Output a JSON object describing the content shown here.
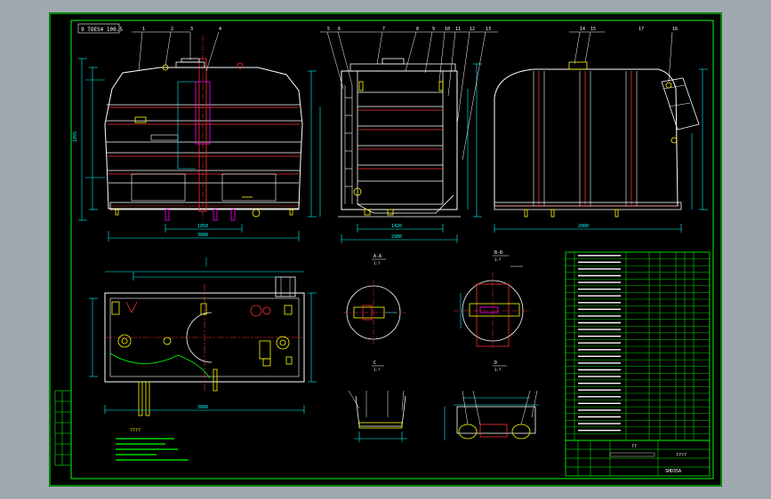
{
  "colors": {
    "background": "#a0a8b0",
    "sheet": "#000000",
    "frame": "#00ff00",
    "geometry": "#ffffff",
    "dimension": "#00ffff",
    "center_line": "#ff3030",
    "accent": "#ffff00",
    "hidden": "#ff00ff"
  },
  "drawing": {
    "stamp": "9 TOES4 100.5",
    "notes_title": "????",
    "title_block_mark": "??",
    "title_block_name": "????",
    "title_block_code": "SHD35A"
  },
  "views": {
    "section_a": {
      "label": "A-A",
      "scale": "1:?"
    },
    "section_b": {
      "label": "B-B",
      "scale": "1:?"
    },
    "section_c": {
      "label": "C",
      "scale": "1:?"
    },
    "section_d": {
      "label": "D",
      "scale": "1:?"
    }
  },
  "dims": {
    "front_overall": "3880",
    "front_base": "1850",
    "side_overall": "2980",
    "side_base": "1420",
    "plan_overall": "3880",
    "height_total": "1895",
    "rear_base": "2000"
  },
  "balloons_top": [
    "1",
    "2",
    "3",
    "4",
    "5",
    "6",
    "7",
    "8",
    "9",
    "10",
    "11",
    "12",
    "13",
    "14",
    "15",
    "16",
    "17"
  ],
  "parts_rows": 28
}
